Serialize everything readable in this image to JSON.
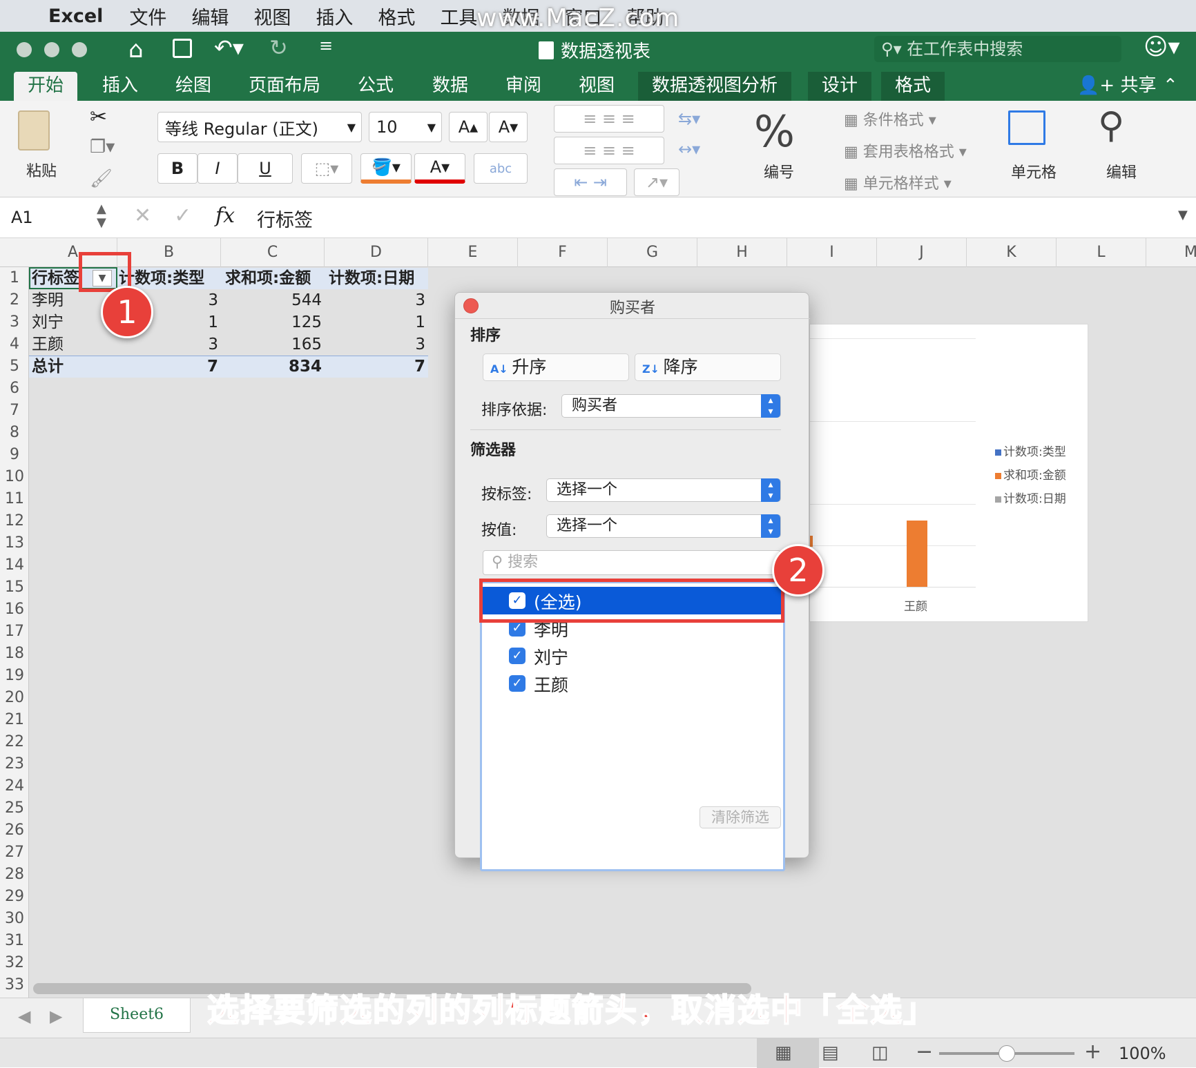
{
  "menubar": {
    "app": "Excel",
    "items": [
      "文件",
      "编辑",
      "视图",
      "插入",
      "格式",
      "工具",
      "数据",
      "窗口",
      "帮助"
    ],
    "watermark": "www.MacZ.com"
  },
  "window": {
    "title": "数据透视表",
    "search_placeholder": "在工作表中搜索"
  },
  "ribbon_tabs": [
    "开始",
    "插入",
    "绘图",
    "页面布局",
    "公式",
    "数据",
    "审阅",
    "视图",
    "数据透视图分析",
    "设计",
    "格式"
  ],
  "share_label": "共享",
  "ribbon": {
    "paste": "粘贴",
    "font_name": "等线 Regular (正文)",
    "font_size": "10",
    "bold": "B",
    "italic": "I",
    "underline": "U",
    "number_label": "编号",
    "cond_format": "条件格式",
    "table_format": "套用表格格式",
    "cell_style": "单元格样式",
    "cells_label": "单元格",
    "edit_label": "编辑",
    "abc": "abc"
  },
  "formula": {
    "name_box": "A1",
    "fx": "fx",
    "content": "行标签"
  },
  "columns": [
    "A",
    "B",
    "C",
    "D",
    "E",
    "F",
    "G",
    "H",
    "I",
    "J",
    "K",
    "L",
    "M"
  ],
  "rows": [
    "1",
    "2",
    "3",
    "4",
    "5",
    "6",
    "7",
    "8",
    "9",
    "10",
    "11",
    "12",
    "13",
    "14",
    "15",
    "16",
    "17",
    "18",
    "19",
    "20",
    "21",
    "22",
    "23",
    "24",
    "25",
    "26",
    "27",
    "28",
    "29",
    "30",
    "31",
    "32",
    "33"
  ],
  "pivot": {
    "headers": [
      "行标签",
      "计数项:类型",
      "求和项:金额",
      "计数项:日期"
    ],
    "rows": [
      [
        "李明",
        "3",
        "544",
        "3"
      ],
      [
        "刘宁",
        "1",
        "125",
        "1"
      ],
      [
        "王颜",
        "3",
        "165",
        "3"
      ]
    ],
    "total": [
      "总计",
      "7",
      "834",
      "7"
    ]
  },
  "dialog": {
    "title": "购买者",
    "sort_section": "排序",
    "asc": "升序",
    "desc": "降序",
    "sort_by_label": "排序依据:",
    "sort_by_value": "购买者",
    "filter_section": "筛选器",
    "by_label": "按标签:",
    "by_label_value": "选择一个",
    "by_value": "按值:",
    "by_value_value": "选择一个",
    "search_placeholder": "搜索",
    "items": [
      "(全选)",
      "李明",
      "刘宁",
      "王颜"
    ],
    "clear": "清除筛选"
  },
  "chart": {
    "legend": [
      "计数项:类型",
      "求和项:金额",
      "计数项:日期"
    ],
    "category_visible": "王颜",
    "colors": [
      "#4472c4",
      "#ed7d31",
      "#a5a5a5"
    ]
  },
  "sheet_tab": "Sheet6",
  "zoom": "100%",
  "annotations": {
    "badge1": "1",
    "badge2": "2",
    "caption": "选择要筛选的列的列标题箭头，取消选中「全选」"
  }
}
